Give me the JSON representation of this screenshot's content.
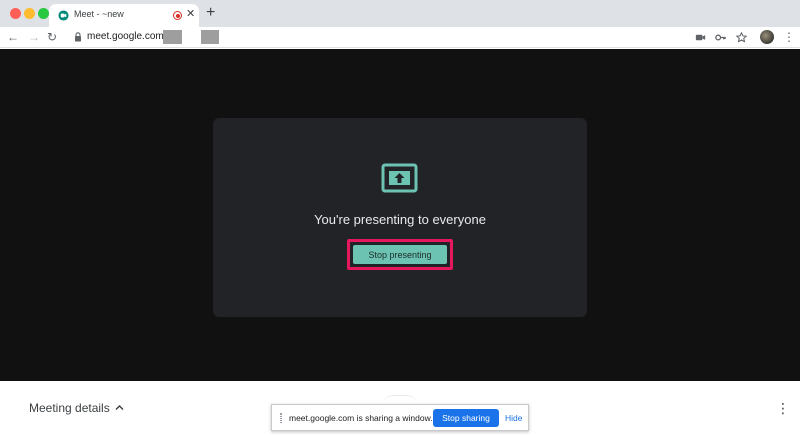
{
  "browser": {
    "tab": {
      "title": "Meet - ~new",
      "close_glyph": "✕",
      "favicon_icon": "meet-icon",
      "recording_icon": "recording-icon"
    },
    "new_tab_glyph": "+",
    "nav": {
      "back_glyph": "←",
      "forward_glyph": "→",
      "reload_glyph": "↻"
    },
    "url": "meet.google.com/",
    "menu_glyph": "⋮"
  },
  "meet": {
    "present_message": "You're presenting to everyone",
    "stop_presenting_label": "Stop presenting",
    "meeting_details_label": "Meeting details",
    "menu_glyph": "⋮"
  },
  "share_bar": {
    "message": "meet.google.com is sharing a window.",
    "stop_sharing_label": "Stop sharing",
    "hide_label": "Hide"
  },
  "colors": {
    "accent_teal": "#6cc3b1",
    "highlight_pink": "#e6175c",
    "stop_sharing_blue": "#1a73e8",
    "stage_bg": "#111111",
    "card_bg": "#222326"
  }
}
